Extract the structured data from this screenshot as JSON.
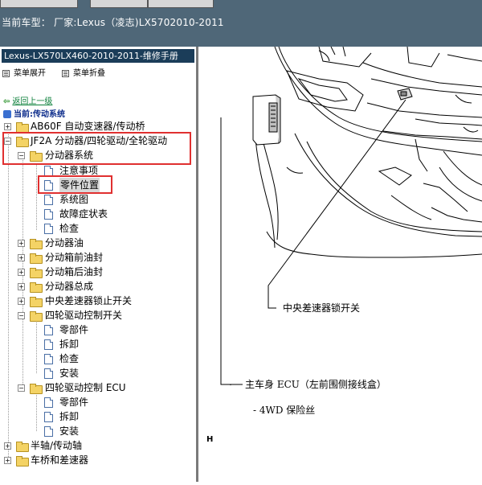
{
  "header": {
    "vehicle_line": "当前车型： 厂家:Lexus（凌志)LX5702010-2011"
  },
  "sidebar": {
    "manual_title": "Lexus-LX570LX460-2010-2011-维修手册",
    "expand_label": "菜单展开",
    "collapse_label": "菜单折叠",
    "back_label": "返回上一级",
    "current_label": "当前:传动系统",
    "tree": [
      {
        "label": "AB60F 自动变速器/传动桥"
      },
      {
        "label": "JF2A 分动器/四轮驱动/全轮驱动"
      },
      {
        "label": "分动器系统"
      },
      {
        "label": "注意事项"
      },
      {
        "label": "零件位置"
      },
      {
        "label": "系统图"
      },
      {
        "label": "故障症状表"
      },
      {
        "label": "检查"
      },
      {
        "label": "分动器油"
      },
      {
        "label": "分动箱前油封"
      },
      {
        "label": "分动箱后油封"
      },
      {
        "label": "分动器总成"
      },
      {
        "label": "中央差速器锁止开关"
      },
      {
        "label": "四轮驱动控制开关"
      },
      {
        "label": "零部件"
      },
      {
        "label": "拆卸"
      },
      {
        "label": "检查"
      },
      {
        "label": "安装"
      },
      {
        "label": "四轮驱动控制 ECU"
      },
      {
        "label": "零部件"
      },
      {
        "label": "拆卸"
      },
      {
        "label": "安装"
      },
      {
        "label": "半轴/传动轴"
      },
      {
        "label": "车桥和差速器"
      }
    ]
  },
  "diagram": {
    "callout_center_diff": "中央差速器锁开关",
    "callout_ecu": "主车身 ECU（左前围侧接线盒）",
    "callout_fuse": "- 4WD 保险丝",
    "marker": "H"
  }
}
